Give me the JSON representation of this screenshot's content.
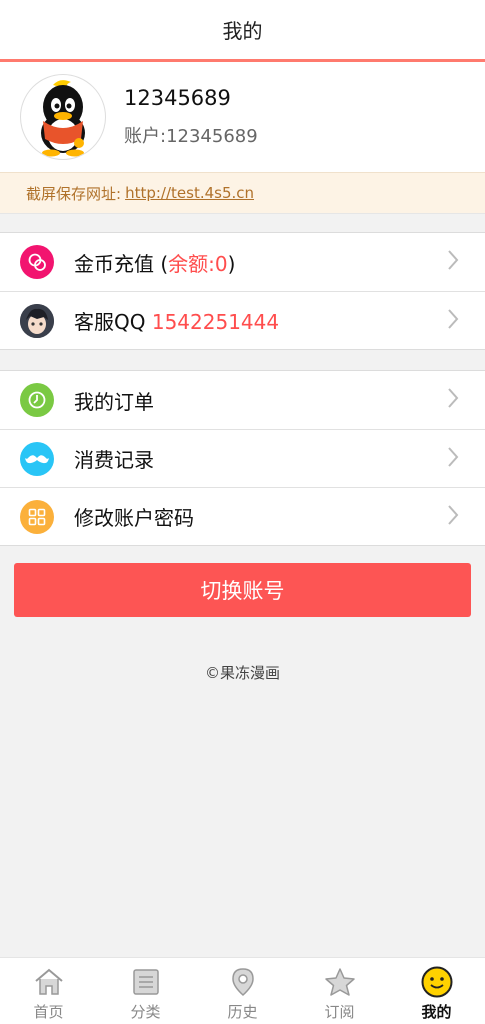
{
  "header": {
    "title": "我的"
  },
  "profile": {
    "name": "12345689",
    "account_label": "账户:12345689"
  },
  "notice": {
    "label": "截屏保存网址:",
    "url": "http://test.4s5.cn"
  },
  "menu_group1": {
    "recharge": {
      "label": "金币充值 (",
      "balance": "余额:0",
      "suffix": ")"
    },
    "service": {
      "label": "客服QQ ",
      "qq": "1542251444"
    }
  },
  "menu_group2": {
    "orders": {
      "label": "我的订单"
    },
    "records": {
      "label": "消费记录"
    },
    "password": {
      "label": "修改账户密码"
    }
  },
  "switch_button": {
    "label": "切换账号"
  },
  "footer": {
    "copyright": "©果冻漫画"
  },
  "tabbar": {
    "items": [
      {
        "label": "首页",
        "icon": "home-icon"
      },
      {
        "label": "分类",
        "icon": "book-icon"
      },
      {
        "label": "历史",
        "icon": "location-pin-icon"
      },
      {
        "label": "订阅",
        "icon": "star-icon"
      },
      {
        "label": "我的",
        "icon": "smiley-face-icon",
        "active": true
      }
    ]
  },
  "colors": {
    "accent_red": "#fd5554",
    "header_underline": "#ff7a6e",
    "notice_text": "#b0722b",
    "notice_bg": "#fdf3e5",
    "recharge_icon": "#f2146f",
    "orders_icon": "#7ac943",
    "records_icon": "#29c5f6",
    "password_icon": "#fbb03b",
    "active_tab_icon": "#ffd200"
  }
}
